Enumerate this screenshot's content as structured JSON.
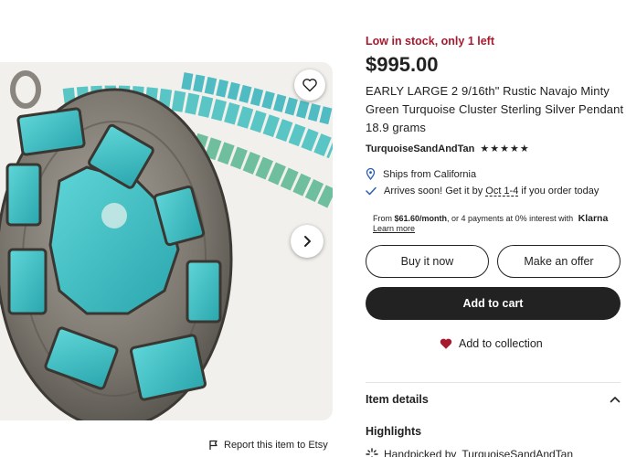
{
  "listing": {
    "stock_notice": "Low in stock, only 1 left",
    "price": "$995.00",
    "title": "EARLY LARGE 2 9/16th\" Rustic Navajo Minty Green Turquoise Cluster Sterling Silver Pendant 18.9 grams",
    "shop_name": "TurquoiseSandAndTan",
    "rating_stars": "★★★★★"
  },
  "shipping": {
    "ships_from": "Ships from California",
    "arrives_prefix": "Arrives soon! Get it by ",
    "arrives_date": "Oct 1-4",
    "arrives_suffix": " if you order today"
  },
  "financing": {
    "prefix": "From ",
    "amount": "$61.60/month",
    "suffix": ", or 4 payments at 0% interest with ",
    "brand": "Klarna",
    "learn_more": "Learn more"
  },
  "actions": {
    "buy_now": "Buy it now",
    "make_offer": "Make an offer",
    "add_to_cart": "Add to cart",
    "add_to_collection": "Add to collection"
  },
  "sections": {
    "item_details": "Item details",
    "highlights": "Highlights",
    "handpicked_prefix": "Handpicked by ",
    "handpicked_shop": "TurquoiseSandAndTan"
  },
  "image_area": {
    "report_label": "Report this item to Etsy"
  },
  "colors": {
    "stock_red": "#a61a2e",
    "heart_red": "#a61a2e",
    "button_dark": "#222222",
    "turquoise": "#3fc3c8"
  },
  "icons": {
    "favorite": "heart-outline-icon",
    "next": "chevron-right-icon",
    "report": "flag-icon",
    "ships": "location-pin-icon",
    "arrives": "checkmark-icon",
    "collection": "heart-filled-icon",
    "details": "chevron-up-icon",
    "handpicked": "sparkle-icon"
  }
}
